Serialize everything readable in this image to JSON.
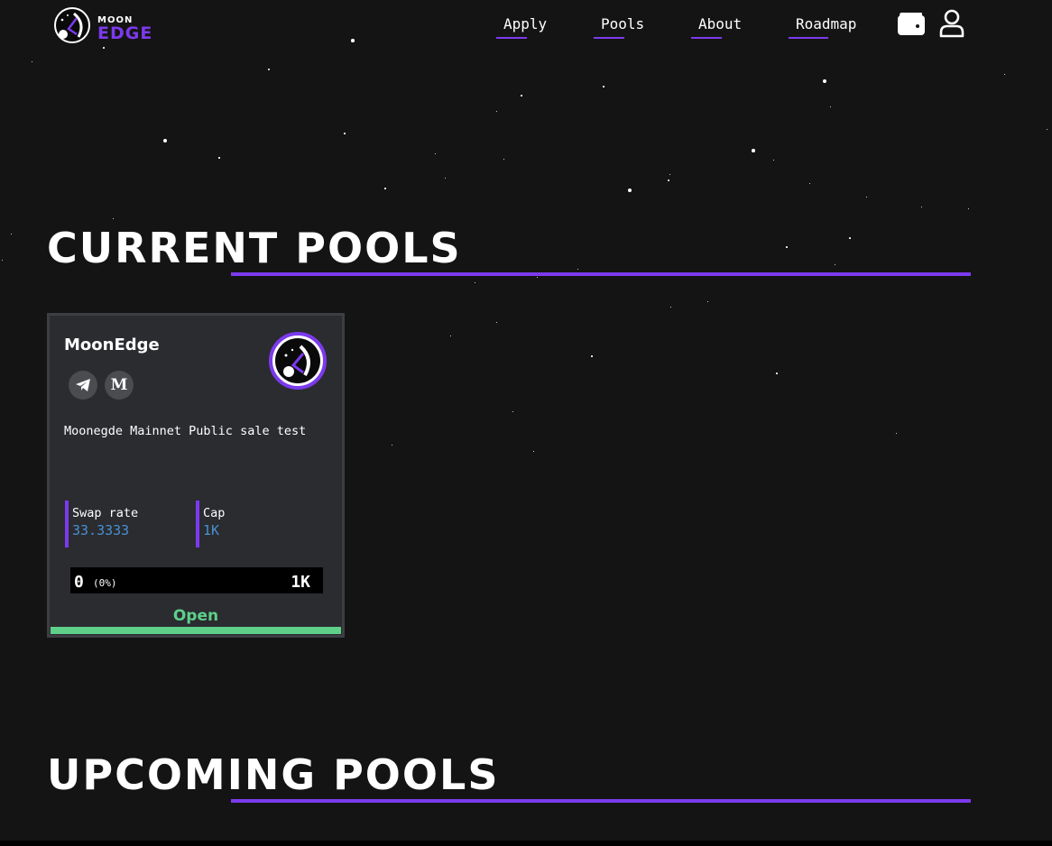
{
  "brand": {
    "line1": "MOON",
    "line2": "EDGE",
    "accent_color": "#7c3aed"
  },
  "nav": {
    "items": [
      {
        "label": "Apply"
      },
      {
        "label": "Pools"
      },
      {
        "label": "About"
      },
      {
        "label": "Roadmap"
      }
    ],
    "wallet_icon": "wallet-icon",
    "account_icon": "user-icon"
  },
  "sections": {
    "current_title": "Current Pools",
    "upcoming_title": "Upcoming Pools"
  },
  "pool_card": {
    "name": "MoonEdge",
    "socials": [
      {
        "icon": "telegram-icon"
      },
      {
        "icon": "medium-icon",
        "glyph": "M"
      }
    ],
    "description": "Moonegde Mainnet Public sale test",
    "stats": [
      {
        "label": "Swap rate",
        "value": "33.3333"
      },
      {
        "label": "Cap",
        "value": "1K"
      }
    ],
    "progress": {
      "raised": "0",
      "percent": "(0%)",
      "fraction": 0,
      "cap": "1K"
    },
    "status": "Open",
    "status_color": "#5ed08a"
  }
}
